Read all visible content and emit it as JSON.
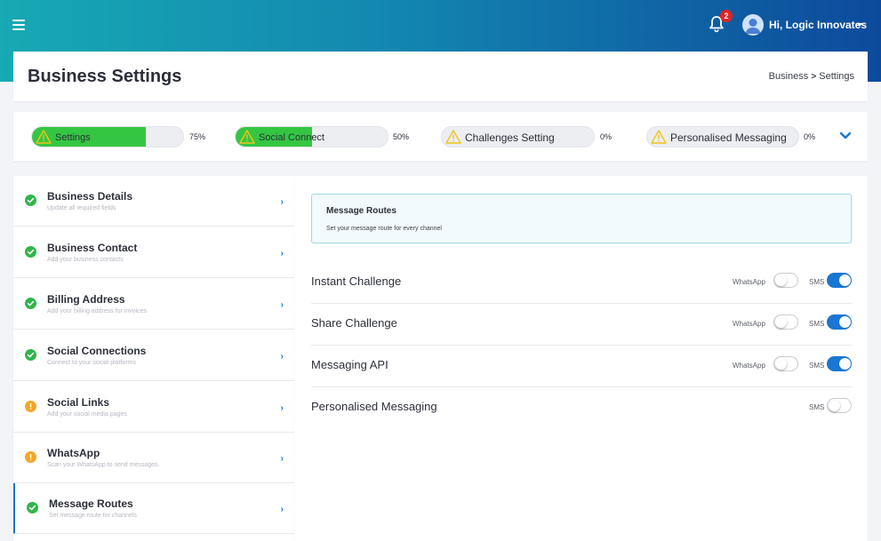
{
  "header": {
    "notification_count": "2",
    "user_greeting": "Hi, Logic Innovates"
  },
  "page": {
    "title": "Business Settings",
    "breadcrumb": {
      "parent": "Business",
      "separator": ">",
      "current": "Settings"
    }
  },
  "progress": [
    {
      "label": "Settings",
      "percent_text": "75%",
      "percent": 75
    },
    {
      "label": "Social Connect",
      "percent_text": "50%",
      "percent": 50
    },
    {
      "label": "Challenges Setting",
      "percent_text": "0%",
      "percent": 0
    },
    {
      "label": "Personalised Messaging",
      "percent_text": "0%",
      "percent": 0
    }
  ],
  "sidebar": {
    "items": [
      {
        "title": "Business Details",
        "subtitle": "Update all required fields",
        "status": "complete"
      },
      {
        "title": "Business Contact",
        "subtitle": "Add your business contacts",
        "status": "complete"
      },
      {
        "title": "Billing Address",
        "subtitle": "Add your billing address for invoices",
        "status": "complete"
      },
      {
        "title": "Social Connections",
        "subtitle": "Connect to your social platforms",
        "status": "complete"
      },
      {
        "title": "Social Links",
        "subtitle": "Add your social media pages",
        "status": "warning"
      },
      {
        "title": "WhatsApp",
        "subtitle": "Scan your WhatsApp to send messages.",
        "status": "warning"
      },
      {
        "title": "Message Routes",
        "subtitle": "Set message route for channels",
        "status": "complete",
        "active": true
      }
    ]
  },
  "main": {
    "info": {
      "title": "Message Routes",
      "subtitle": "Set your message route for every channel"
    },
    "routes": [
      {
        "name": "Instant Challenge",
        "whatsapp_label": "WhatsApp",
        "whatsapp_on": false,
        "sms_label": "SMS",
        "sms_on": true
      },
      {
        "name": "Share Challenge",
        "whatsapp_label": "WhatsApp",
        "whatsapp_on": false,
        "sms_label": "SMS",
        "sms_on": true
      },
      {
        "name": "Messaging API",
        "whatsapp_label": "WhatsApp",
        "whatsapp_on": false,
        "sms_label": "SMS",
        "sms_on": true
      },
      {
        "name": "Personalised Messaging",
        "sms_label": "SMS",
        "sms_on": false
      }
    ]
  },
  "colors": {
    "accent": "#1976d2",
    "progress_fill": "#34c643",
    "complete": "#30b54a",
    "warning": "#f5a623",
    "badge": "#e02424"
  },
  "icons": {
    "menu": "hamburger-icon",
    "notifications": "bell-icon",
    "avatar": "user-avatar-icon",
    "expand": "chevron-down-icon",
    "warning": "warning-triangle-icon",
    "complete": "check-circle-icon",
    "incomplete": "exclamation-circle-icon"
  }
}
